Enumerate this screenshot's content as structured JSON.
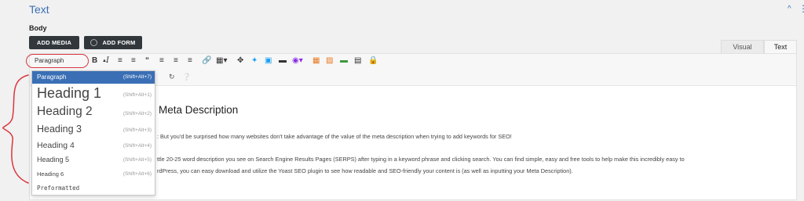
{
  "section": {
    "title": "Text"
  },
  "field": {
    "label": "Body"
  },
  "buttons": {
    "add_media": "ADD MEDIA",
    "add_form": "ADD FORM"
  },
  "tabs": {
    "visual": "Visual",
    "text": "Text"
  },
  "toolbar": {
    "format_value": "Paragraph",
    "icons": [
      "bold-icon",
      "italic-icon",
      "bullet-list-icon",
      "numbered-list-icon",
      "blockquote-icon",
      "align-left-icon",
      "align-center-icon",
      "align-right-icon",
      "link-icon",
      "table-icon",
      "fullscreen-icon",
      "twitter-icon",
      "calendar-icon",
      "readmore-icon",
      "plugin-icon",
      "shortcode-icon",
      "color-icon",
      "divider-icon",
      "lock-icon"
    ]
  },
  "dropdown": {
    "items": [
      {
        "label": "Paragraph",
        "shortcut": "(Shift+Alt+7)"
      },
      {
        "label": "Heading 1",
        "shortcut": "(Shift+Alt+1)"
      },
      {
        "label": "Heading 2",
        "shortcut": "(Shift+Alt+2)"
      },
      {
        "label": "Heading 3",
        "shortcut": "(Shift+Alt+3)"
      },
      {
        "label": "Heading 4",
        "shortcut": "(Shift+Alt+4)"
      },
      {
        "label": "Heading 5",
        "shortcut": "(Shift+Alt+5)"
      },
      {
        "label": "Heading 6",
        "shortcut": "(Shift+Alt+6)"
      },
      {
        "label": "Preformatted",
        "shortcut": ""
      }
    ]
  },
  "content": {
    "heading": "Meta Description",
    "p1": ": But you'd be surprised how many websites don't take advantage of the value of the meta description when trying to add keywords for SEO!",
    "p2": "ttle 20-25 word description you see on Search Engine Results Pages (SERPS) after typing in a keyword phrase and clicking search. You can find simple, easy and free tools to help make this incredibly easy to",
    "p3": "rdPress, you can easy download and utilize the Yoast SEO plugin to see how readable and SEO-friendly your content is (as well as inputting your Meta Description)."
  }
}
